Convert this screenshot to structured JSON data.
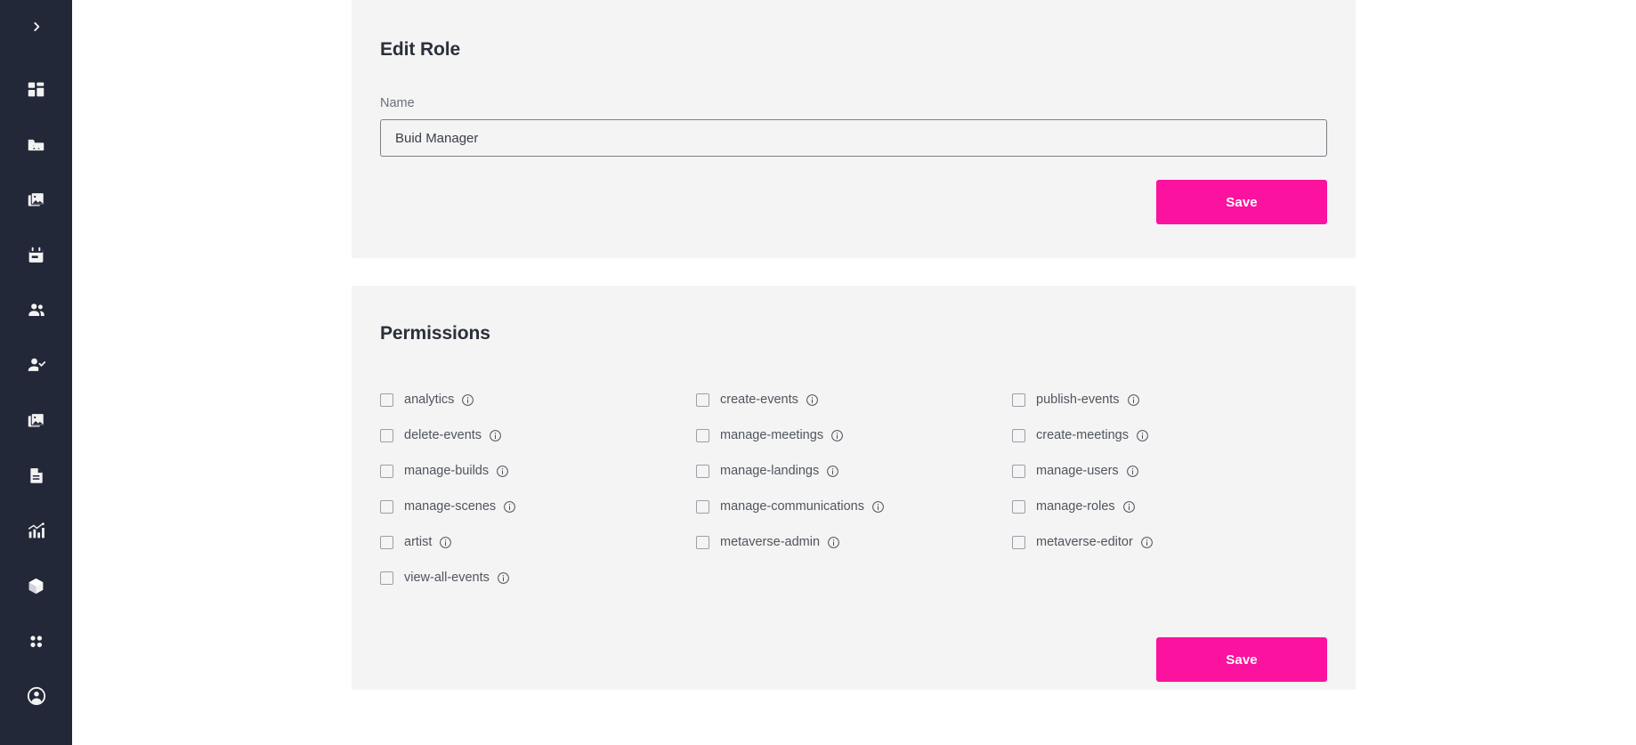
{
  "sidebar": {
    "toggle": {
      "icon": "chevron-right-icon",
      "label": ""
    },
    "items": [
      {
        "icon": "dashboard-icon",
        "name": "dashboard"
      },
      {
        "icon": "folder-image-icon",
        "name": "media-library"
      },
      {
        "icon": "image-stack-icon",
        "name": "scenes"
      },
      {
        "icon": "calendar-icon",
        "name": "events"
      },
      {
        "icon": "users-icon",
        "name": "users"
      },
      {
        "icon": "user-check-icon",
        "name": "roles"
      },
      {
        "icon": "image-card-icon",
        "name": "landings"
      },
      {
        "icon": "document-icon",
        "name": "documents"
      },
      {
        "icon": "bar-chart-icon",
        "name": "analytics"
      },
      {
        "icon": "cube-icon",
        "name": "builds"
      },
      {
        "icon": "grid-dots-icon",
        "name": "apps"
      },
      {
        "icon": "account-circle-icon",
        "name": "account"
      }
    ]
  },
  "edit_role": {
    "title": "Edit Role",
    "name_label": "Name",
    "name_value": "Buid Manager",
    "name_placeholder": "Name",
    "save_label": "Save"
  },
  "permissions": {
    "title": "Permissions",
    "save_label": "Save",
    "info_icon": "info-circle-icon",
    "items": [
      {
        "label": "analytics",
        "checked": false
      },
      {
        "label": "create-events",
        "checked": false
      },
      {
        "label": "publish-events",
        "checked": false
      },
      {
        "label": "delete-events",
        "checked": false
      },
      {
        "label": "manage-meetings",
        "checked": false
      },
      {
        "label": "create-meetings",
        "checked": false
      },
      {
        "label": "manage-builds",
        "checked": false
      },
      {
        "label": "manage-landings",
        "checked": false
      },
      {
        "label": "manage-users",
        "checked": false
      },
      {
        "label": "manage-scenes",
        "checked": false
      },
      {
        "label": "manage-communications",
        "checked": false
      },
      {
        "label": "manage-roles",
        "checked": false
      },
      {
        "label": "artist",
        "checked": false
      },
      {
        "label": "metaverse-admin",
        "checked": false
      },
      {
        "label": "metaverse-editor",
        "checked": false
      },
      {
        "label": "view-all-events",
        "checked": false
      }
    ]
  },
  "colors": {
    "accent": "#fb129e",
    "sidebar_bg": "#222838",
    "card_bg": "#f4f4f4",
    "page_bg": "#ffffff"
  }
}
